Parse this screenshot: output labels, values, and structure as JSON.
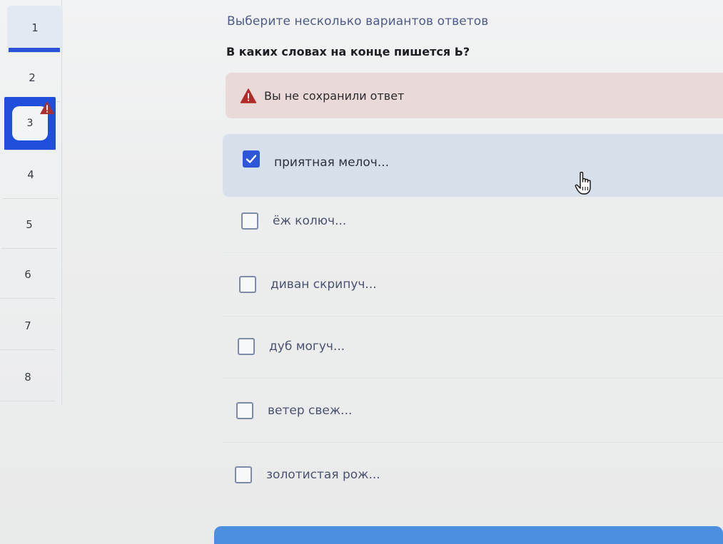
{
  "nav": {
    "items": [
      {
        "label": "1"
      },
      {
        "label": "2"
      },
      {
        "label": "3"
      },
      {
        "label": "4"
      },
      {
        "label": "5"
      },
      {
        "label": "6"
      },
      {
        "label": "7"
      },
      {
        "label": "8"
      }
    ],
    "active_index": 3,
    "warning_on": 3
  },
  "main": {
    "instruction": "Выберите несколько вариантов ответов",
    "question": "В каких словах на конце пишется Ь?",
    "alert": {
      "text": "Вы не сохранили ответ",
      "icon": "warning-triangle-icon",
      "color": "#b22a2a"
    },
    "options": [
      {
        "label": "приятная мелоч...",
        "checked": true
      },
      {
        "label": "ёж колюч...",
        "checked": false
      },
      {
        "label": "диван скрипуч...",
        "checked": false
      },
      {
        "label": "дуб могуч...",
        "checked": false
      },
      {
        "label": "ветер свеж...",
        "checked": false
      },
      {
        "label": "золотистая рож...",
        "checked": false
      }
    ]
  },
  "colors": {
    "accent": "#2a52d8",
    "selected_bg": "#d7e0ea",
    "alert_bg": "#e9d9d9",
    "button": "#4c8fe0"
  }
}
